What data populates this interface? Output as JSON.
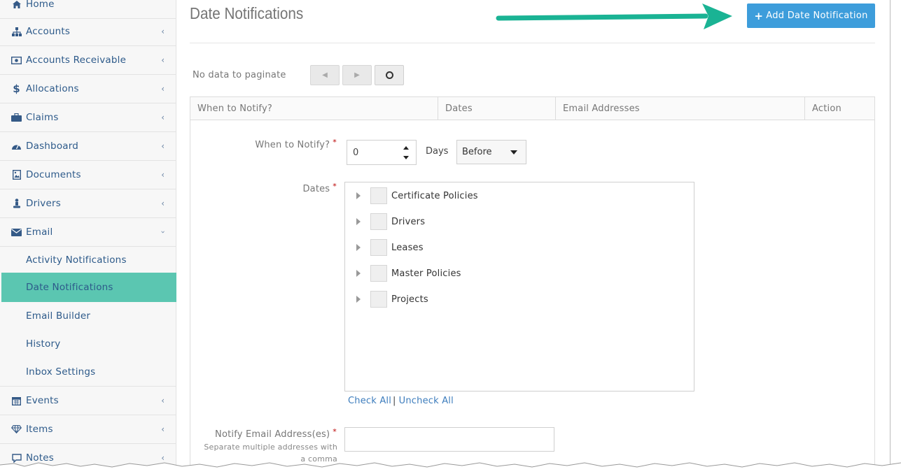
{
  "sidebar": {
    "items": [
      {
        "label": "Home",
        "icon": "home-icon",
        "has_chevron": false
      },
      {
        "label": "Accounts",
        "icon": "sitemap-icon",
        "has_chevron": true
      },
      {
        "label": "Accounts Receivable",
        "icon": "money-icon",
        "has_chevron": true
      },
      {
        "label": "Allocations",
        "icon": "dollar-icon",
        "has_chevron": true
      },
      {
        "label": "Claims",
        "icon": "briefcase-icon",
        "has_chevron": true
      },
      {
        "label": "Dashboard",
        "icon": "dashboard-icon",
        "has_chevron": true
      },
      {
        "label": "Documents",
        "icon": "image-file-icon",
        "has_chevron": true
      },
      {
        "label": "Drivers",
        "icon": "driver-icon",
        "has_chevron": true
      },
      {
        "label": "Email",
        "icon": "envelope-icon",
        "has_chevron": true,
        "expanded": true
      },
      {
        "label": "Events",
        "icon": "calendar-icon",
        "has_chevron": true
      },
      {
        "label": "Items",
        "icon": "diamond-icon",
        "has_chevron": true
      },
      {
        "label": "Notes",
        "icon": "comment-icon",
        "has_chevron": true
      }
    ],
    "email_subitems": [
      {
        "label": "Activity Notifications",
        "active": false
      },
      {
        "label": "Date Notifications",
        "active": true
      },
      {
        "label": "Email Builder",
        "active": false
      },
      {
        "label": "History",
        "active": false
      },
      {
        "label": "Inbox Settings",
        "active": false
      }
    ],
    "active_color": "#5bc6b1"
  },
  "main": {
    "title": "Date Notifications",
    "add_button_label": "Add Date Notification",
    "add_button_color": "#3d9ddb",
    "arrow_color": "#1ab394",
    "pagination": {
      "text": "No data to paginate"
    },
    "table": {
      "columns": [
        "When to Notify?",
        "Dates",
        "Email Addresses",
        "Action"
      ]
    },
    "form": {
      "when_label": "When to Notify?",
      "when_value": "0",
      "days_label": "Days",
      "timing_select": "Before",
      "dates_label": "Dates",
      "tree_items": [
        "Certificate Policies",
        "Drivers",
        "Leases",
        "Master Policies",
        "Projects"
      ],
      "check_all": "Check All",
      "separator": "|",
      "uncheck_all": "Uncheck All",
      "email_label": "Notify Email Address(es)",
      "email_hint_line1": "Separate multiple addresses with",
      "email_hint_line2": "a comma",
      "required_mark": "*"
    }
  }
}
